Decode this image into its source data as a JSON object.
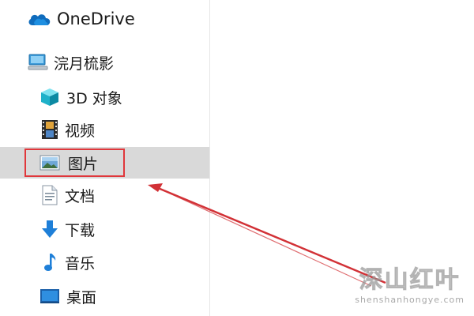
{
  "nav": {
    "onedrive": {
      "label": "OneDrive",
      "icon": "cloud-icon"
    },
    "pc": {
      "label": "浣月梳影",
      "icon": "computer-icon"
    },
    "objects3d": {
      "label": "3D 对象",
      "icon": "cube-3d-icon"
    },
    "videos": {
      "label": "视频",
      "icon": "film-icon"
    },
    "pictures": {
      "label": "图片",
      "icon": "picture-icon",
      "selected": true
    },
    "documents": {
      "label": "文档",
      "icon": "document-icon"
    },
    "downloads": {
      "label": "下载",
      "icon": "download-arrow-icon"
    },
    "music": {
      "label": "音乐",
      "icon": "music-note-icon"
    },
    "desktop": {
      "label": "桌面",
      "icon": "desktop-icon"
    }
  },
  "watermark": {
    "main": "深山红叶",
    "sub": "shenshanhongye.com"
  },
  "colors": {
    "selection_bg": "#d9d9d9",
    "annotation_red": "#e0373b",
    "onedrive_blue": "#0f6cbd"
  }
}
